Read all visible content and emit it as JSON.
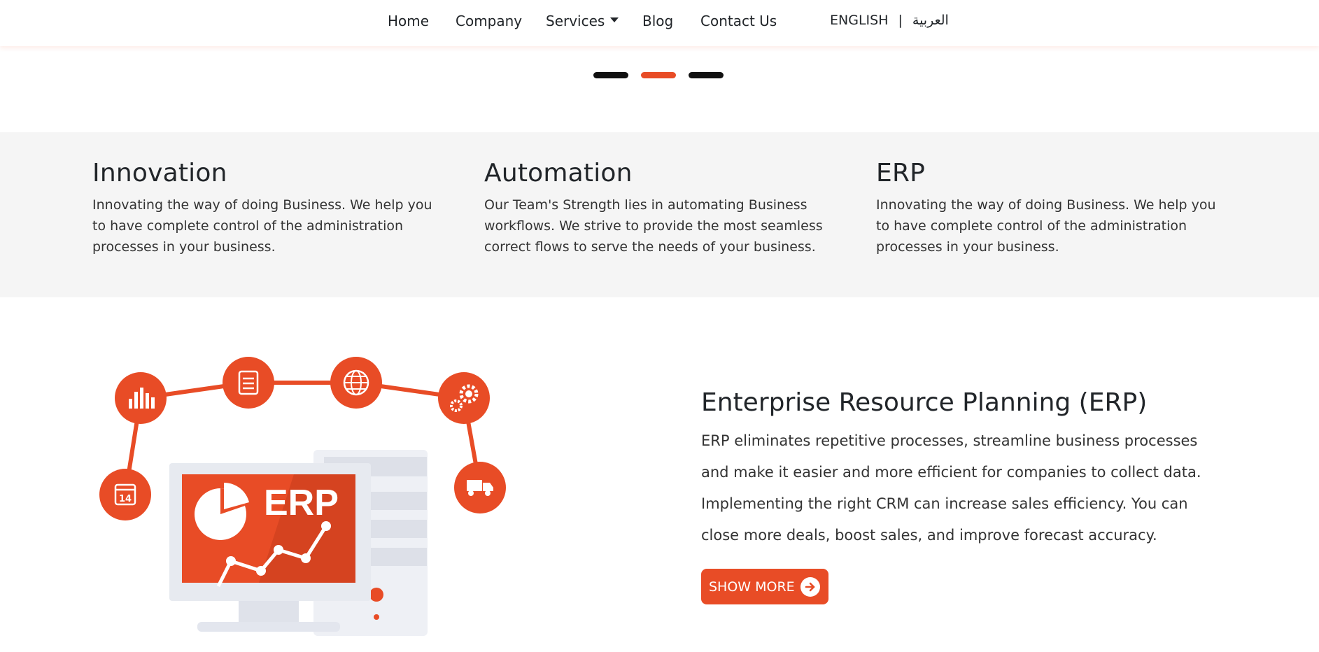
{
  "nav": {
    "items": [
      {
        "label": "Home"
      },
      {
        "label": "Company"
      },
      {
        "label": "Services"
      },
      {
        "label": "Blog"
      },
      {
        "label": "Contact Us"
      }
    ],
    "lang_en": "ENGLISH",
    "lang_sep": "|",
    "lang_ar": "العربية"
  },
  "slider": {
    "count": 3,
    "active_index": 1
  },
  "features": [
    {
      "title": "Innovation",
      "text": "Innovating the way of doing Business. We help you to have complete control of the administration processes in your business."
    },
    {
      "title": "Automation",
      "text": "Our Team's Strength lies in automating Business workflows. We strive to provide the most seamless correct flows to serve the needs of your business."
    },
    {
      "title": "ERP",
      "text": "Innovating the way of doing Business. We help you to have complete control of the administration processes in your business."
    }
  ],
  "erp": {
    "title": "Enterprise Resource Planning (ERP)",
    "text": "ERP eliminates repetitive processes, streamline business processes and make it easier and more efficient for companies to collect data. Implementing the right CRM can increase sales efficiency. You can close more deals, boost sales, and improve forecast accuracy.",
    "button_label": "SHOW MORE",
    "illustration": {
      "screen_label": "ERP",
      "calendar_day": "14",
      "icons": [
        "calendar-icon",
        "bar-chart-icon",
        "clipboard-icon",
        "globe-icon",
        "gears-icon",
        "truck-icon"
      ]
    }
  },
  "colors": {
    "accent": "#e84c26",
    "band": "#f5f5f5",
    "text": "#212529"
  }
}
